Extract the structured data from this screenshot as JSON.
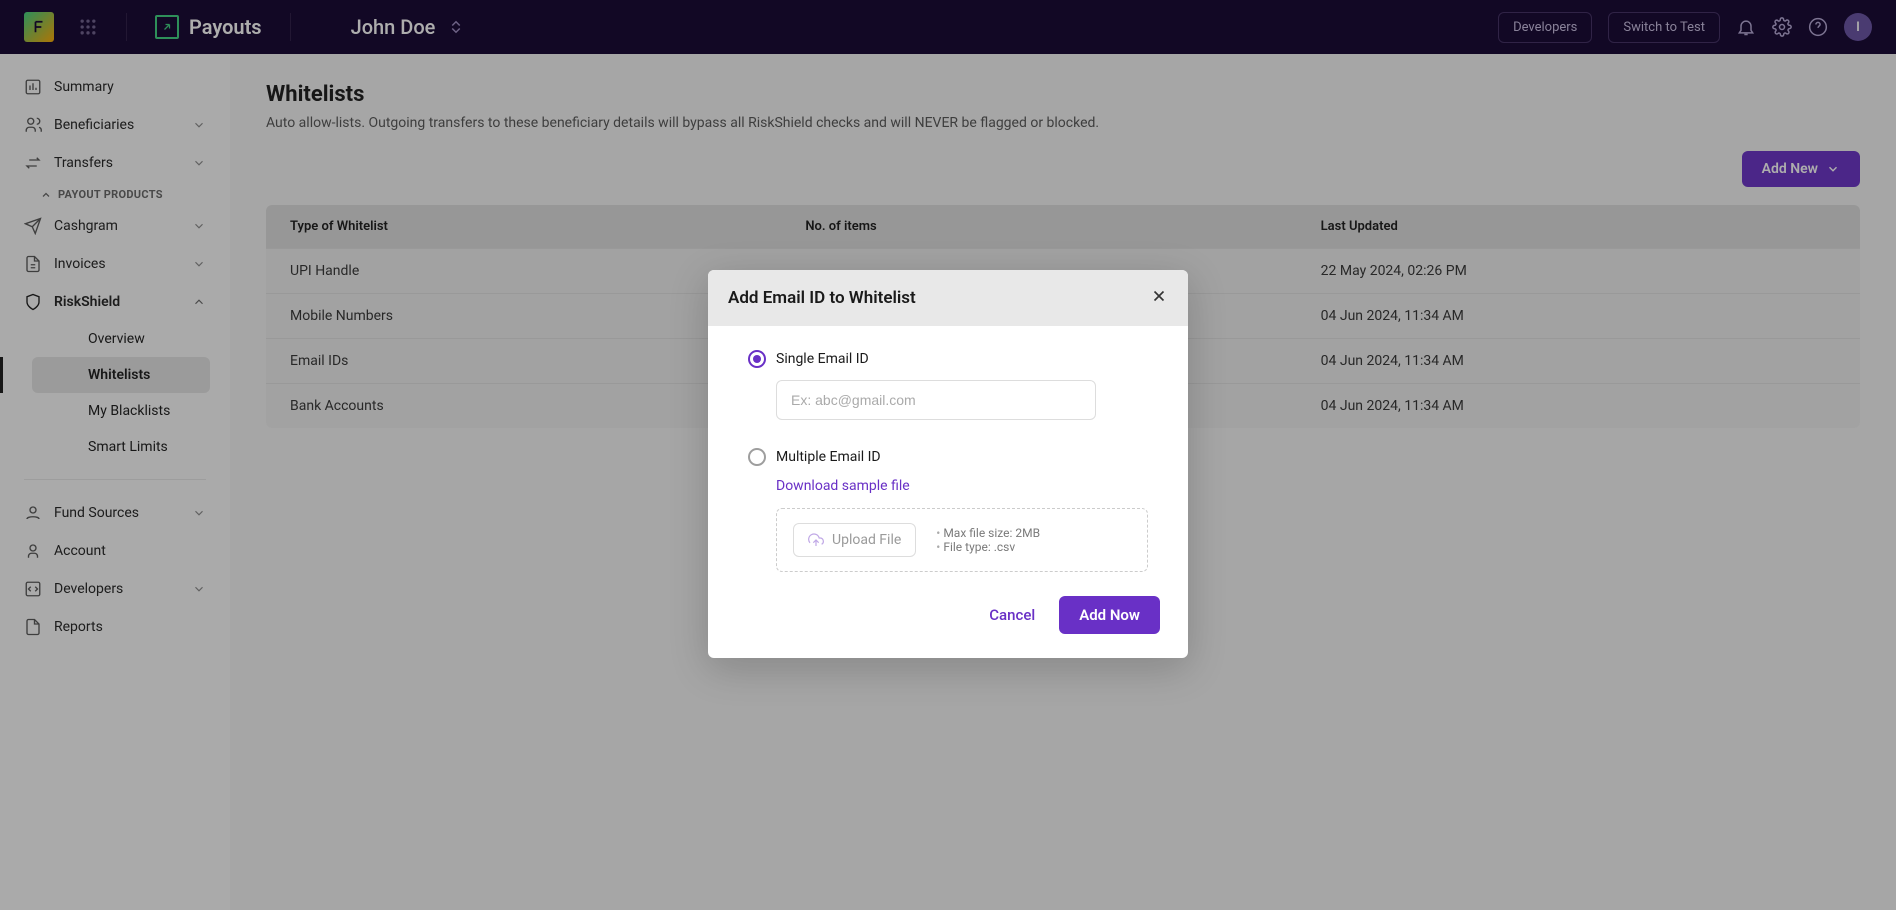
{
  "topbar": {
    "product": "Payouts",
    "user": "John Doe",
    "developers": "Developers",
    "switch": "Switch to Test",
    "avatar_initial": "I"
  },
  "sidebar": {
    "summary": "Summary",
    "beneficiaries": "Beneficiaries",
    "transfers": "Transfers",
    "section_payout_products": "PAYOUT PRODUCTS",
    "cashgram": "Cashgram",
    "invoices": "Invoices",
    "riskshield": "RiskShield",
    "riskshield_sub": {
      "overview": "Overview",
      "whitelists": "Whitelists",
      "blacklists": "My Blacklists",
      "smartlimits": "Smart Limits"
    },
    "fundsources": "Fund Sources",
    "account": "Account",
    "developers": "Developers",
    "reports": "Reports"
  },
  "page": {
    "title": "Whitelists",
    "subtitle": "Auto allow-lists. Outgoing transfers to these beneficiary details will bypass all RiskShield checks and will NEVER be flagged or blocked.",
    "add_new": "Add New"
  },
  "table": {
    "headers": {
      "type": "Type of Whitelist",
      "count": "No. of items",
      "updated": "Last Updated"
    },
    "rows": [
      {
        "type": "UPI Handle",
        "count": "",
        "updated": "22 May 2024, 02:26 PM"
      },
      {
        "type": "Mobile Numbers",
        "count": "",
        "updated": "04 Jun 2024, 11:34 AM"
      },
      {
        "type": "Email IDs",
        "count": "",
        "updated": "04 Jun 2024, 11:34 AM"
      },
      {
        "type": "Bank Accounts",
        "count": "",
        "updated": "04 Jun 2024, 11:34 AM"
      }
    ]
  },
  "modal": {
    "title": "Add Email ID to Whitelist",
    "single_label": "Single Email ID",
    "placeholder": "Ex: abc@gmail.com",
    "multiple_label": "Multiple Email ID",
    "download_sample": "Download sample file",
    "upload_label": "Upload File",
    "hint_size": "Max file size: 2MB",
    "hint_type": "File type: .csv",
    "cancel": "Cancel",
    "submit": "Add Now"
  }
}
